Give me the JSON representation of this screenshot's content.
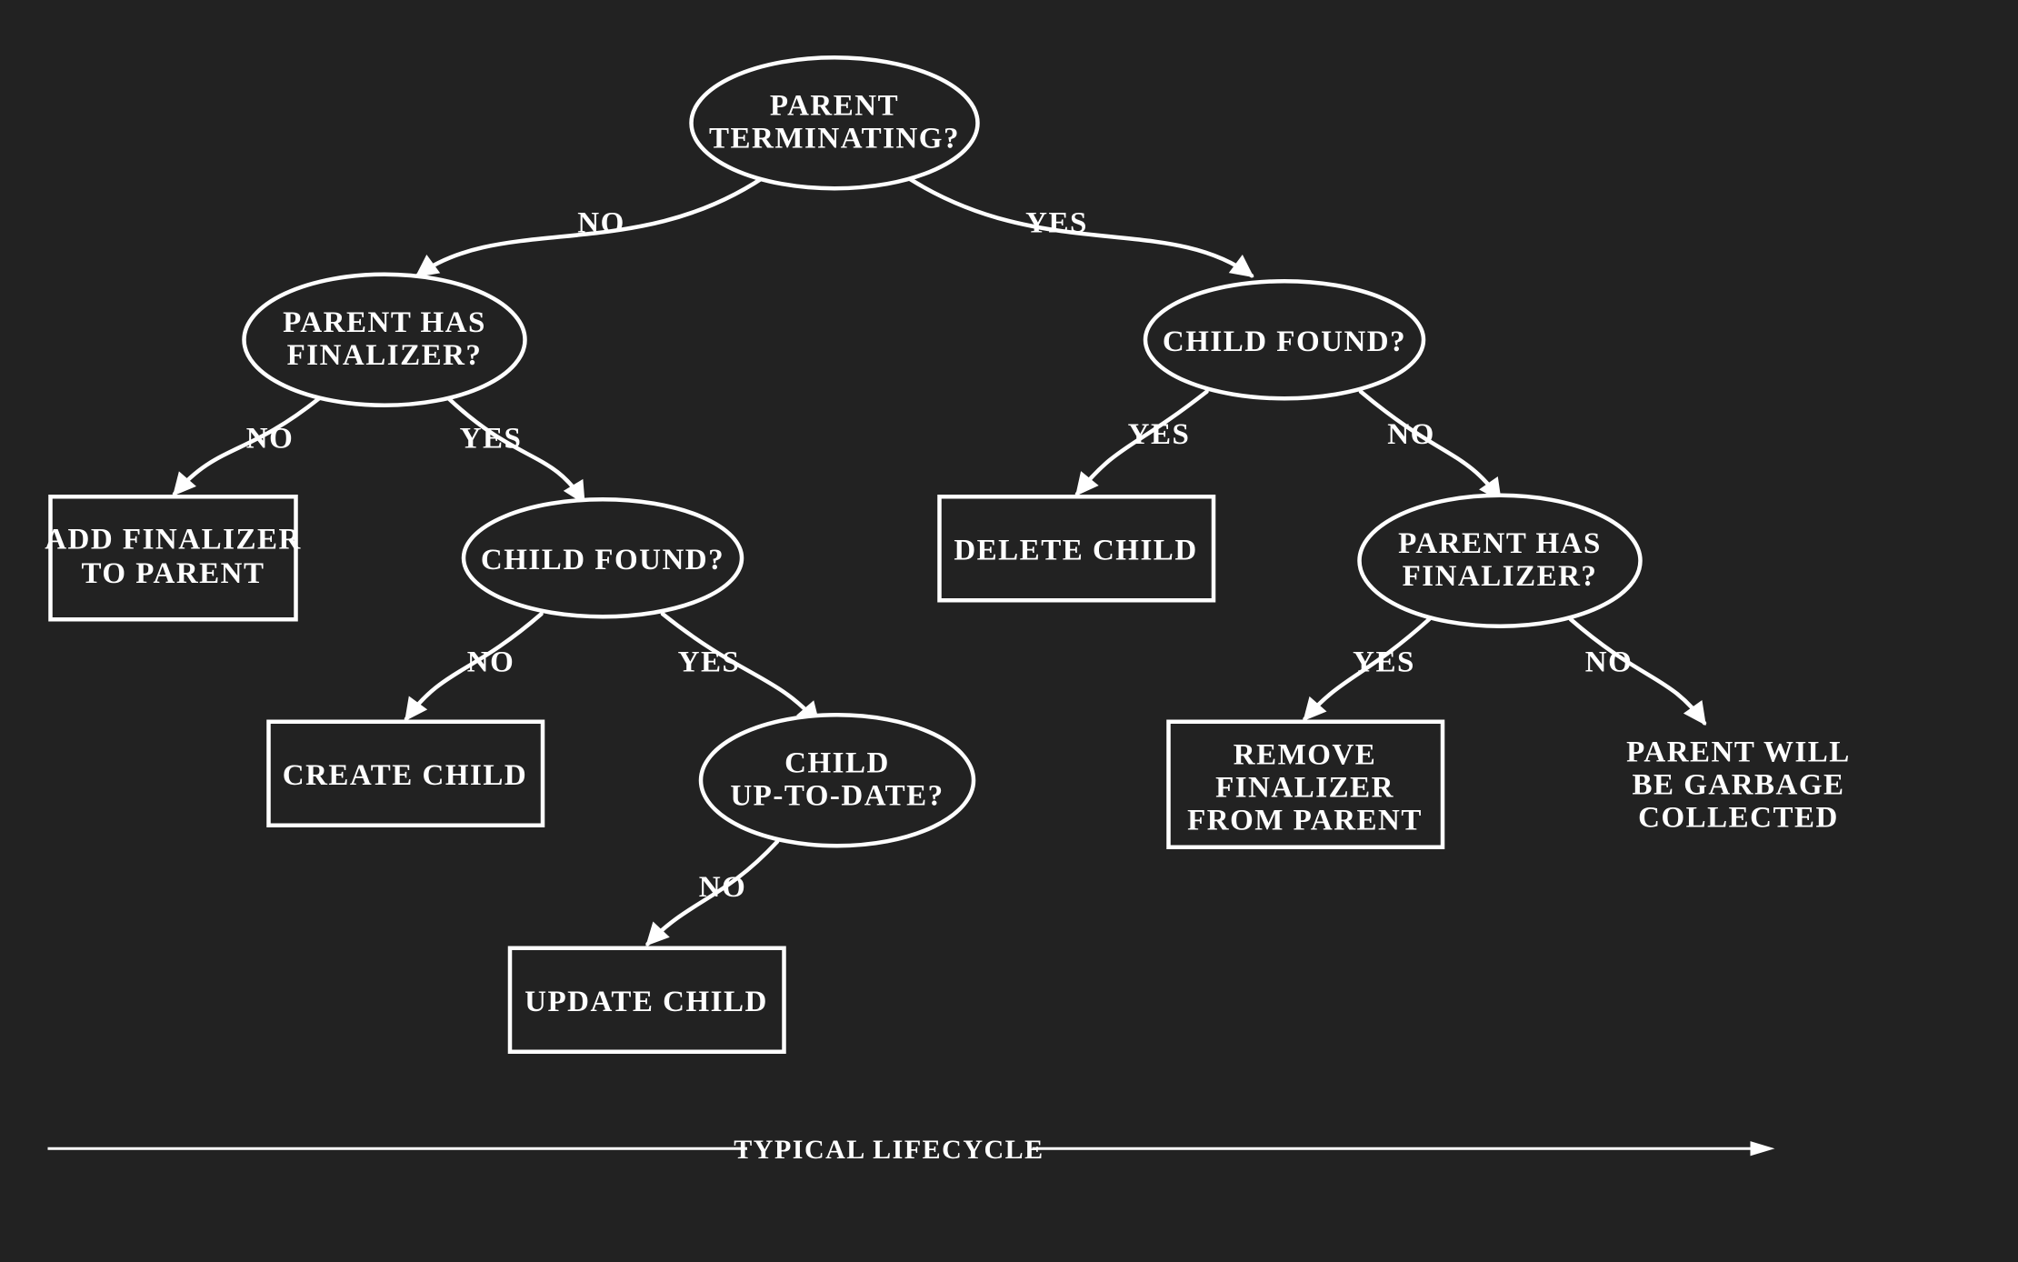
{
  "colors": {
    "bg": "#222222",
    "fg": "#FFFFFF"
  },
  "stroke_width": 3,
  "nodes": {
    "root": {
      "text1": "PARENT",
      "text2": "TERMINATING?"
    },
    "l_fin": {
      "text1": "PARENT HAS",
      "text2": "FINALIZER?"
    },
    "r_found": {
      "text1": "CHILD FOUND?"
    },
    "l_addfin": {
      "text1": "ADD FINALIZER",
      "text2": "TO PARENT"
    },
    "l_found": {
      "text1": "CHILD FOUND?"
    },
    "r_delete": {
      "text1": "DELETE CHILD"
    },
    "r_fin": {
      "text1": "PARENT HAS",
      "text2": "FINALIZER?"
    },
    "l_create": {
      "text1": "CREATE CHILD"
    },
    "l_utd": {
      "text1": "CHILD",
      "text2": "UP-TO-DATE?"
    },
    "r_remove": {
      "text1": "REMOVE",
      "text2": "FINALIZER",
      "text3": "FROM PARENT"
    },
    "r_gc": {
      "text1": "PARENT WILL",
      "text2": "BE GARBAGE",
      "text3": "COLLECTED"
    },
    "l_update": {
      "text1": "UPDATE CHILD"
    }
  },
  "edges": {
    "root_l": "NO",
    "root_r": "YES",
    "lfin_l": "NO",
    "lfin_r": "YES",
    "rfound_l": "YES",
    "rfound_r": "NO",
    "lfound_l": "NO",
    "lfound_r": "YES",
    "rfin_l": "YES",
    "rfin_r": "NO",
    "lutd_l": "NO"
  },
  "footer": "TYPICAL LIFECYCLE"
}
